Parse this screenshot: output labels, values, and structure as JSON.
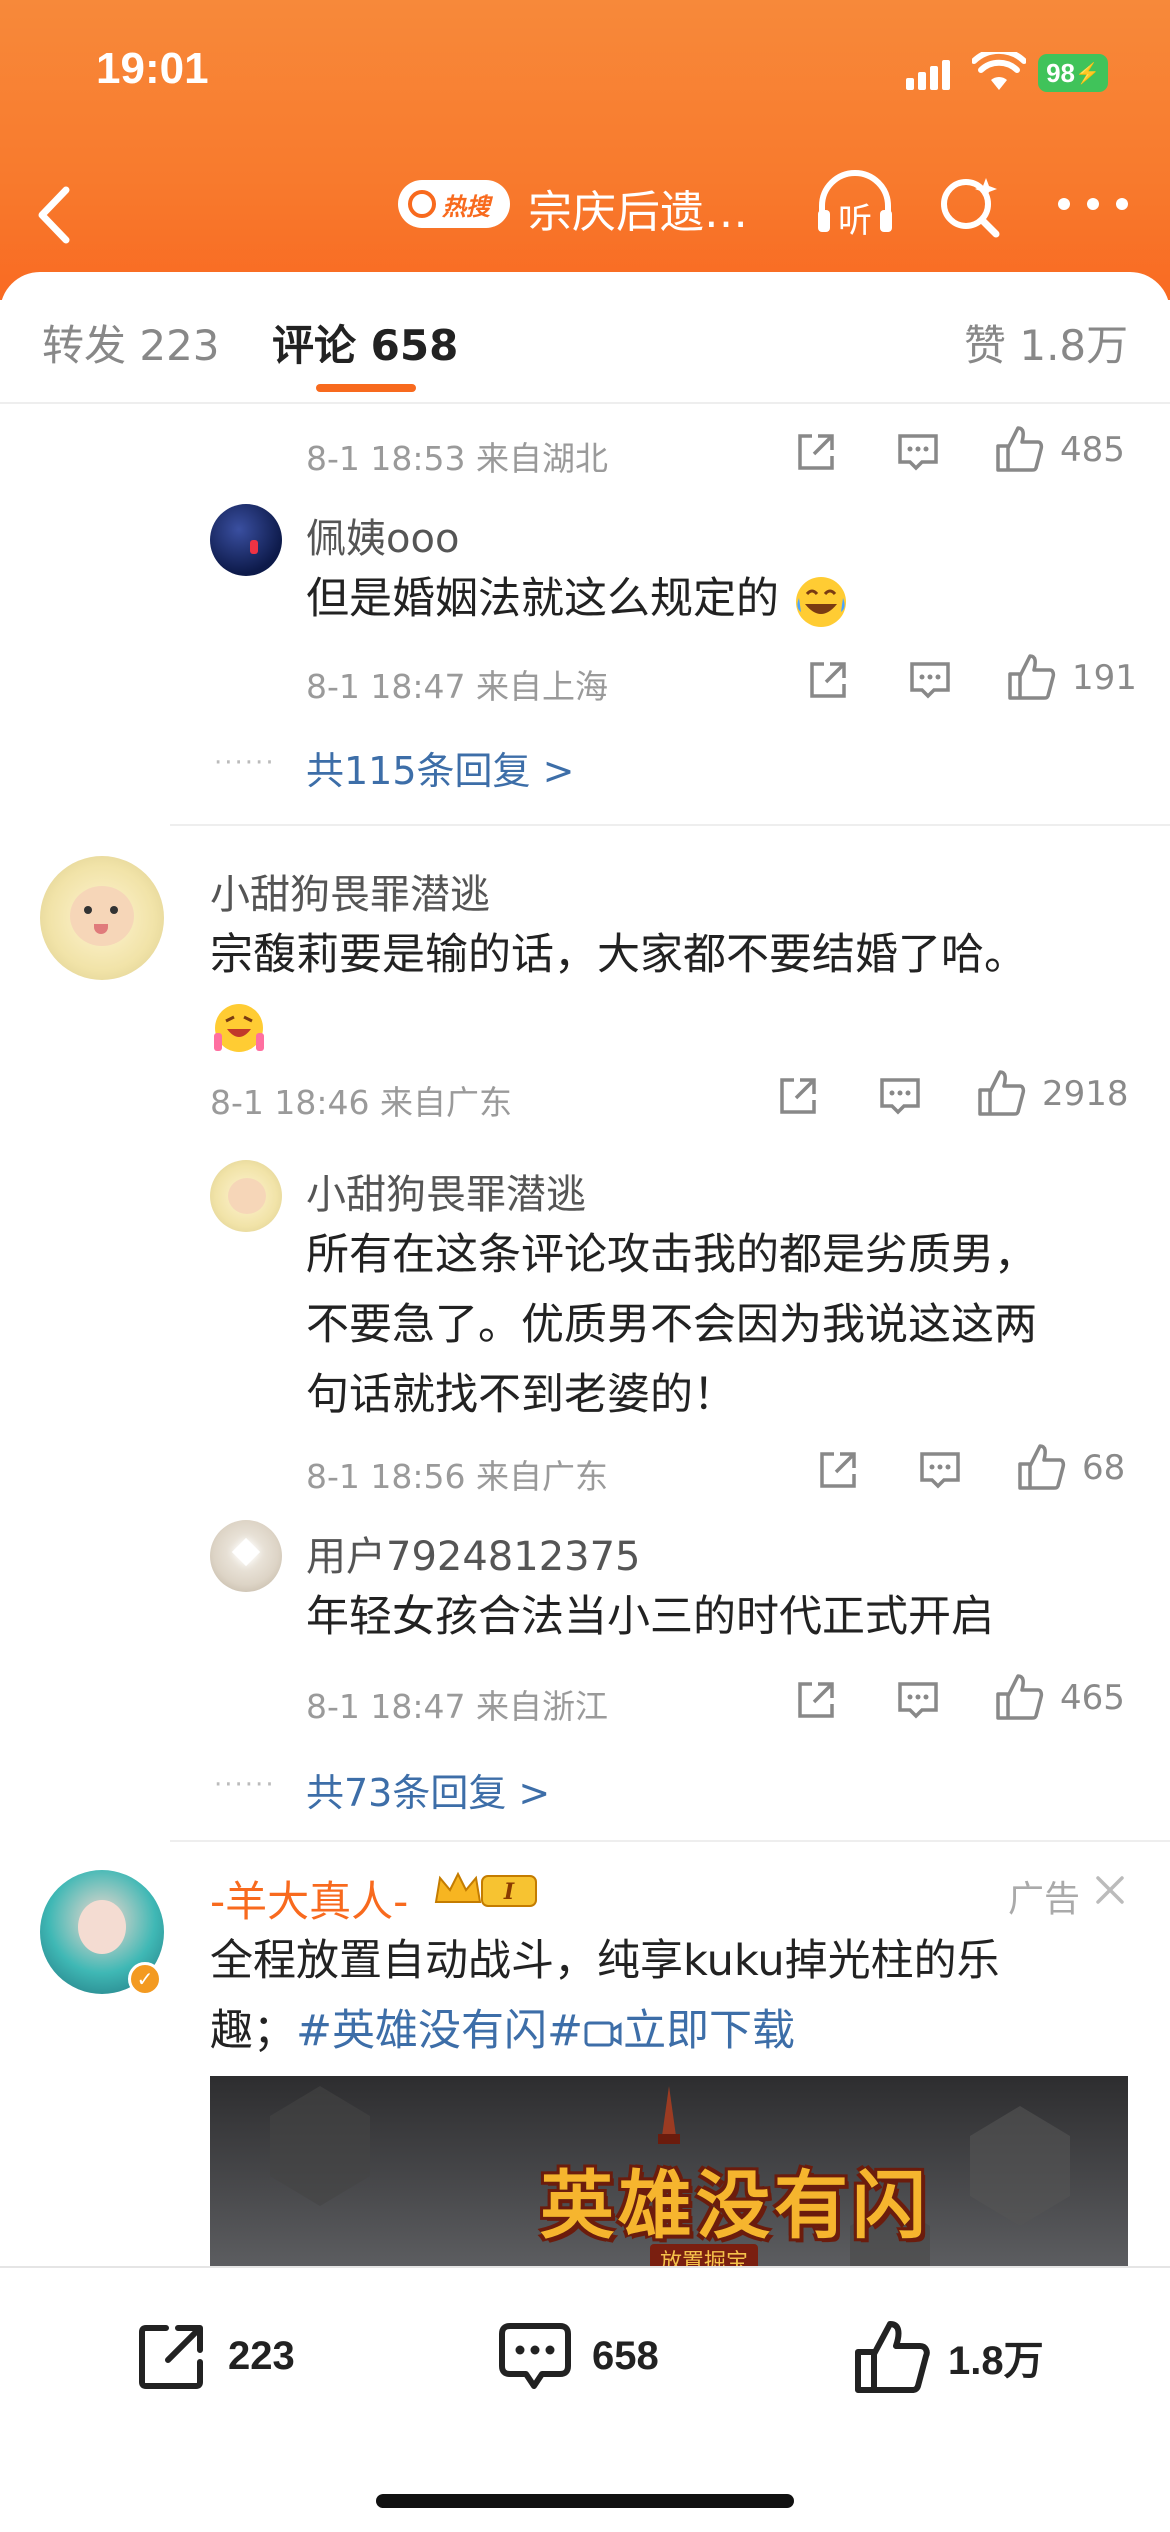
{
  "status_bar": {
    "time": "19:01",
    "battery": "98"
  },
  "nav": {
    "hot_tag": "热搜",
    "title": "宗庆后遗…",
    "listen_label": "听"
  },
  "tabs": {
    "repost": "转发 223",
    "comment": "评论 658",
    "like": "赞 1.8万"
  },
  "comments": [
    {
      "meta": "8-1 18:53  来自湖北",
      "likes": "485"
    },
    {
      "user": "佩姨ooo",
      "text": "但是婚姻法就这么规定的",
      "meta": "8-1 18:47  来自上海",
      "likes": "191"
    },
    {
      "more_replies": "共115条回复 >"
    },
    {
      "user": "小甜狗畏罪潜逃",
      "text": "宗馥莉要是输的话，大家都不要结婚了哈。",
      "meta": "8-1 18:46  来自广东",
      "likes": "2918"
    },
    {
      "user": "小甜狗畏罪潜逃",
      "text_lines": [
        "所有在这条评论攻击我的都是劣质男，",
        "不要急了。优质男不会因为我说这这两",
        "句话就找不到老婆的！"
      ],
      "meta": "8-1 18:56  来自广东",
      "likes": "68"
    },
    {
      "user": "用户7924812375",
      "text": "年轻女孩合法当小三的时代正式开启",
      "meta": "8-1 18:47  来自浙江",
      "likes": "465"
    },
    {
      "more_replies": "共73条回复 >"
    }
  ],
  "ad": {
    "name": "-羊大真人-",
    "badge": "I",
    "tag": "广告",
    "text_line1": "全程放置自动战斗，纯享kuku掉光柱的乐",
    "text_line2_prefix": "趣；",
    "hashtag": "#英雄没有闪#",
    "download": "立即下载",
    "banner_title": "英雄没有闪",
    "banner_sub": "放置掘宝"
  },
  "bottom_bar": {
    "repost": "223",
    "comment": "658",
    "like": "1.8万"
  },
  "colors": {
    "accent": "#f86a1e",
    "link": "#3d6ea8"
  },
  "icons": [
    "back-icon",
    "listen-icon",
    "search-icon",
    "more-icon",
    "share-icon",
    "comment-icon",
    "like-icon",
    "close-icon"
  ]
}
